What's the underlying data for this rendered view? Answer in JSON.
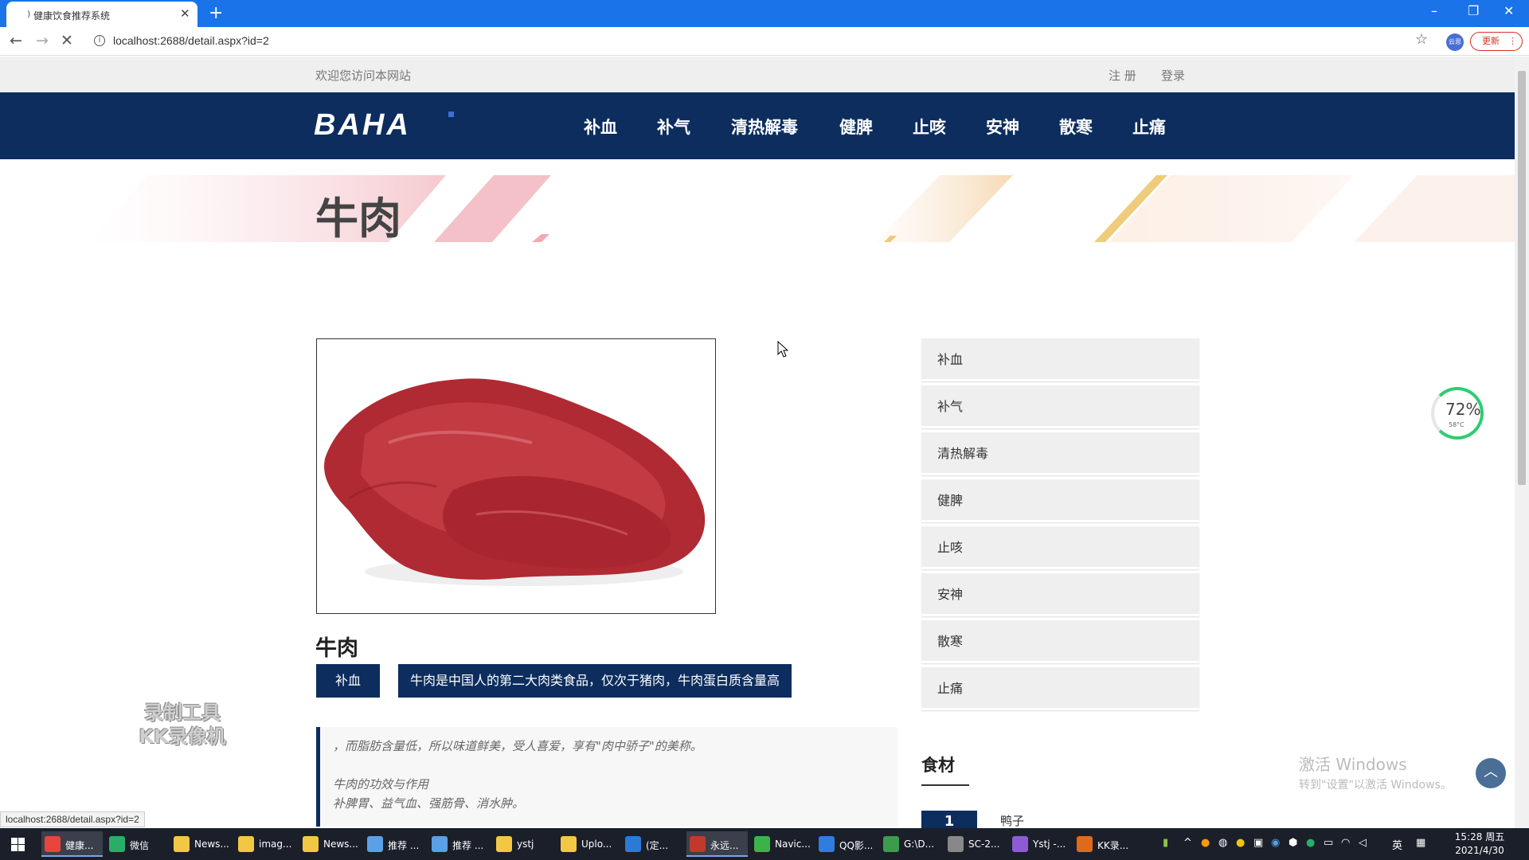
{
  "browser": {
    "tab_title": "健康饮食推荐系统",
    "url": "localhost:2688/detail.aspx?id=2",
    "update_label": "更新",
    "profile_label": "云思"
  },
  "site": {
    "welcome": "欢迎您访问本网站",
    "register": "注 册",
    "login": "登录",
    "logo": "BAHA",
    "nav": [
      "补血",
      "补气",
      "清热解毒",
      "健脾",
      "止咳",
      "安神",
      "散寒",
      "止痛"
    ]
  },
  "detail": {
    "page_title": "牛肉",
    "image_alt": "beef",
    "name": "牛肉",
    "category_tag": "补血",
    "summary": "牛肉是中国人的第二大肉类食品，仅次于猪肉，牛肉蛋白质含量高",
    "description_lines": [
      "，而脂肪含量低，所以味道鲜美，受人喜爱，享有\"肉中骄子\"的美称。",
      "",
      "牛肉的功效与作用",
      "补脾胃、益气血、强筋骨、消水肿。"
    ]
  },
  "sidebar": {
    "items": [
      "补血",
      "补气",
      "清热解毒",
      "健脾",
      "止咳",
      "安神",
      "散寒",
      "止痛"
    ],
    "food_title": "食材",
    "top_rank": "1",
    "top_food": "鸭子"
  },
  "overlay": {
    "perf_percent": "72%",
    "perf_temp": "58°C",
    "watermark_line1": "录制工具",
    "watermark_line2": "KK录像机",
    "activate_line1": "激活 Windows",
    "activate_line2": "转到\"设置\"以激活 Windows。",
    "status_url": "localhost:2688/detail.aspx?id=2"
  },
  "taskbar": {
    "items": [
      {
        "label": "健康...",
        "color": "#e8453c"
      },
      {
        "label": "微信",
        "color": "#2aae67"
      },
      {
        "label": "News...",
        "color": "#f2c744"
      },
      {
        "label": "imag...",
        "color": "#f2c744"
      },
      {
        "label": "News...",
        "color": "#f2c744"
      },
      {
        "label": "推荐 ...",
        "color": "#5aa0e8"
      },
      {
        "label": "推荐 ...",
        "color": "#5aa0e8"
      },
      {
        "label": "ystj",
        "color": "#f2c744"
      },
      {
        "label": "Uplo...",
        "color": "#f2c744"
      },
      {
        "label": "(定...",
        "color": "#2b7bd6"
      },
      {
        "label": "永远...",
        "color": "#c0392b"
      },
      {
        "label": "Navic...",
        "color": "#3cb34a"
      },
      {
        "label": "QQ影...",
        "color": "#2f7de1"
      },
      {
        "label": "G:\\D...",
        "color": "#3f9b4c"
      },
      {
        "label": "SC-2...",
        "color": "#888888"
      },
      {
        "label": "Ystj -...",
        "color": "#8e5bd6"
      },
      {
        "label": "KK录...",
        "color": "#e06a1b"
      }
    ],
    "ime": "英",
    "time": "15:28 周五",
    "date": "2021/4/30"
  },
  "colors": {
    "brand_navy": "#0c2d5e",
    "browser_blue": "#1a73e8",
    "sidebar_bg": "#efefef"
  }
}
